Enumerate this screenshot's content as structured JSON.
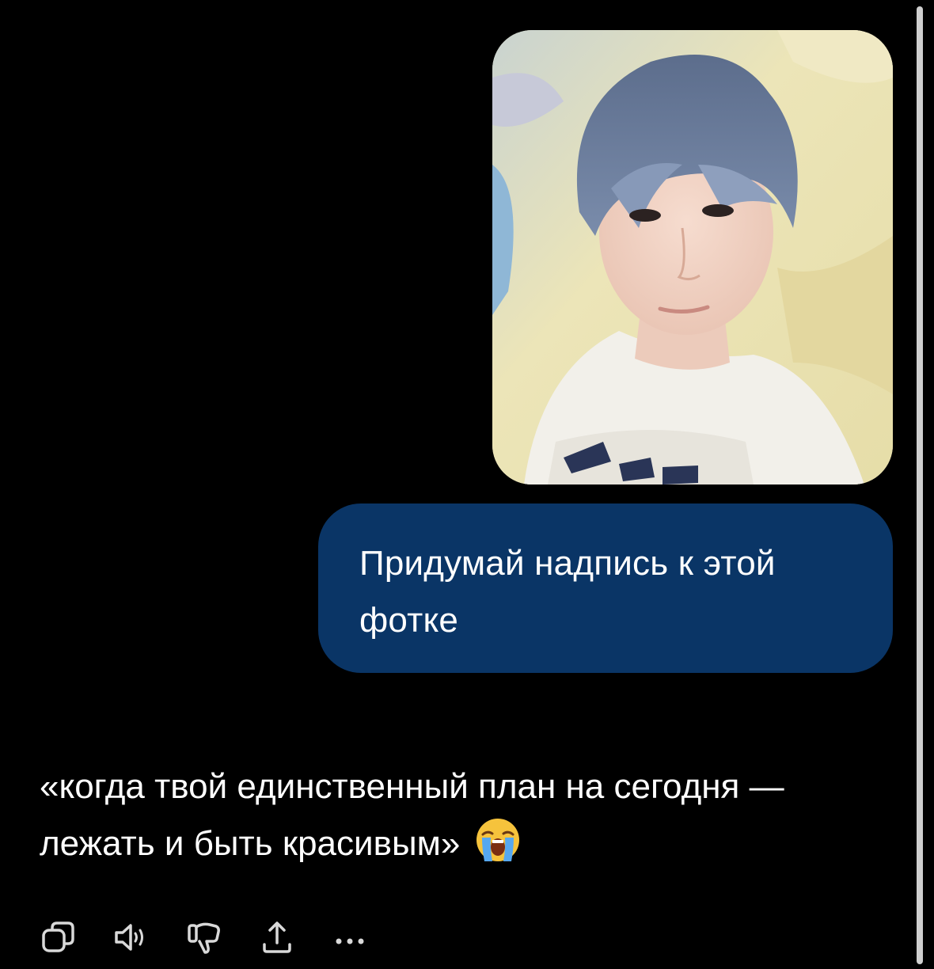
{
  "conversation": {
    "user_message": {
      "image_alt": "Selfie of a young person with blue-grey hair lying on a yellow pillow",
      "text": "Придумай надпись к этой фотке"
    },
    "assistant_message": {
      "text": "«когда твой единственный план на сегодня — лежать и быть красивым»",
      "emoji": "loudly-crying-face"
    }
  },
  "colors": {
    "background": "#000000",
    "bubble": "#0a3566",
    "text": "#ffffff",
    "icon": "#d9d9d9"
  },
  "actions": [
    {
      "name": "copy-icon"
    },
    {
      "name": "read-aloud-icon"
    },
    {
      "name": "thumbs-down-icon"
    },
    {
      "name": "share-icon"
    },
    {
      "name": "more-icon"
    }
  ]
}
